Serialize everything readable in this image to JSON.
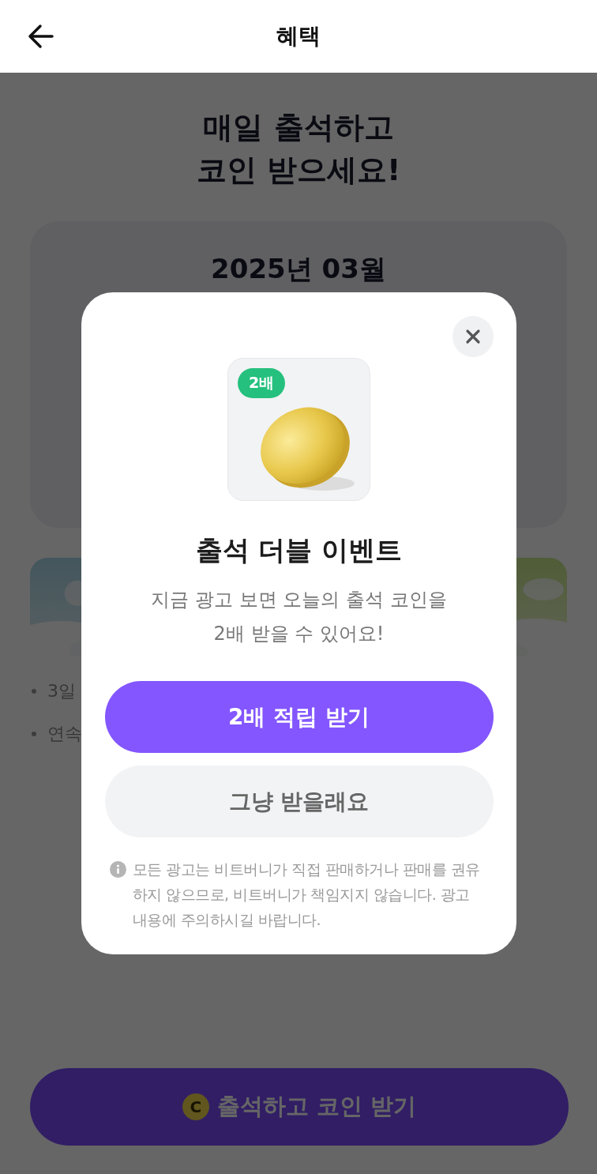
{
  "header": {
    "title": "혜택"
  },
  "page": {
    "heading": [
      "매일 출석하고",
      "코인 받으세요!"
    ],
    "calendar": {
      "month": "2025년 03월"
    },
    "bullets": [
      "3일",
      "연속"
    ],
    "cta": {
      "label": "출석하고 코인 받기",
      "icon_text": "C"
    }
  },
  "modal": {
    "badge": "2배",
    "title": "출석 더블 이벤트",
    "description": [
      "지금 광고 보면 오늘의 출석 코인을",
      "2배 받을 수 있어요!"
    ],
    "primary_button": "2배 적립 받기",
    "secondary_button": "그냥 받을래요",
    "notice": "모든 광고는 비트버니가 직접 판매하거나 판매를 권유하지 않으므로, 비트버니가 책임지지 않습니다. 광고 내용에 주의하시길 바랍니다."
  }
}
